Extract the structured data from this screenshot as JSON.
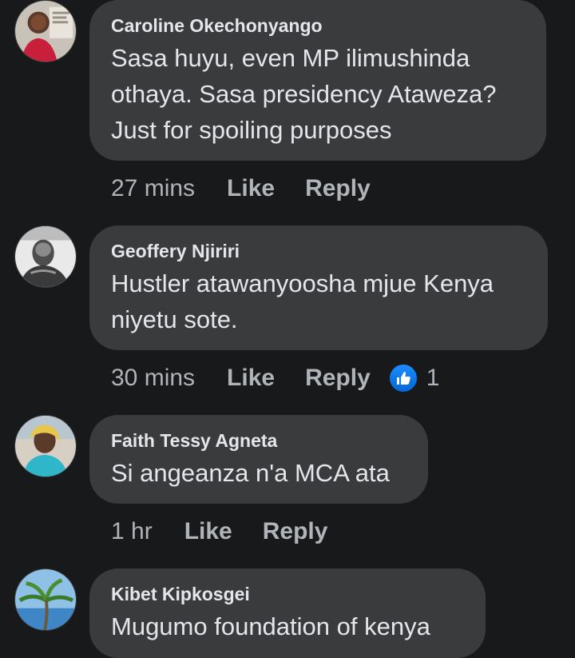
{
  "comments": [
    {
      "author": "Caroline Okechonyango",
      "text": "Sasa huyu, even MP ilimushinda othaya. Sasa presidency Ataweza? Just for spoiling purposes",
      "time": "27 mins",
      "like_label": "Like",
      "reply_label": "Reply"
    },
    {
      "author": "Geoffery Njiriri",
      "text": "Hustler atawanyoosha mjue Kenya niyetu sote.",
      "time": "30 mins",
      "like_label": "Like",
      "reply_label": "Reply",
      "reactions": {
        "icon": "like-icon",
        "count": "1",
        "color": "#1877f2"
      }
    },
    {
      "author": "Faith Tessy Agneta",
      "text": "Si angeanza n'a MCA ata",
      "time": "1 hr",
      "like_label": "Like",
      "reply_label": "Reply"
    },
    {
      "author": "Kibet Kipkosgei",
      "text": "Mugumo foundation of kenya"
    }
  ],
  "colors": {
    "background": "#18191a",
    "bubble": "#3a3b3c",
    "primary_text": "#e4e6eb",
    "secondary_text": "#b0b3b8"
  }
}
